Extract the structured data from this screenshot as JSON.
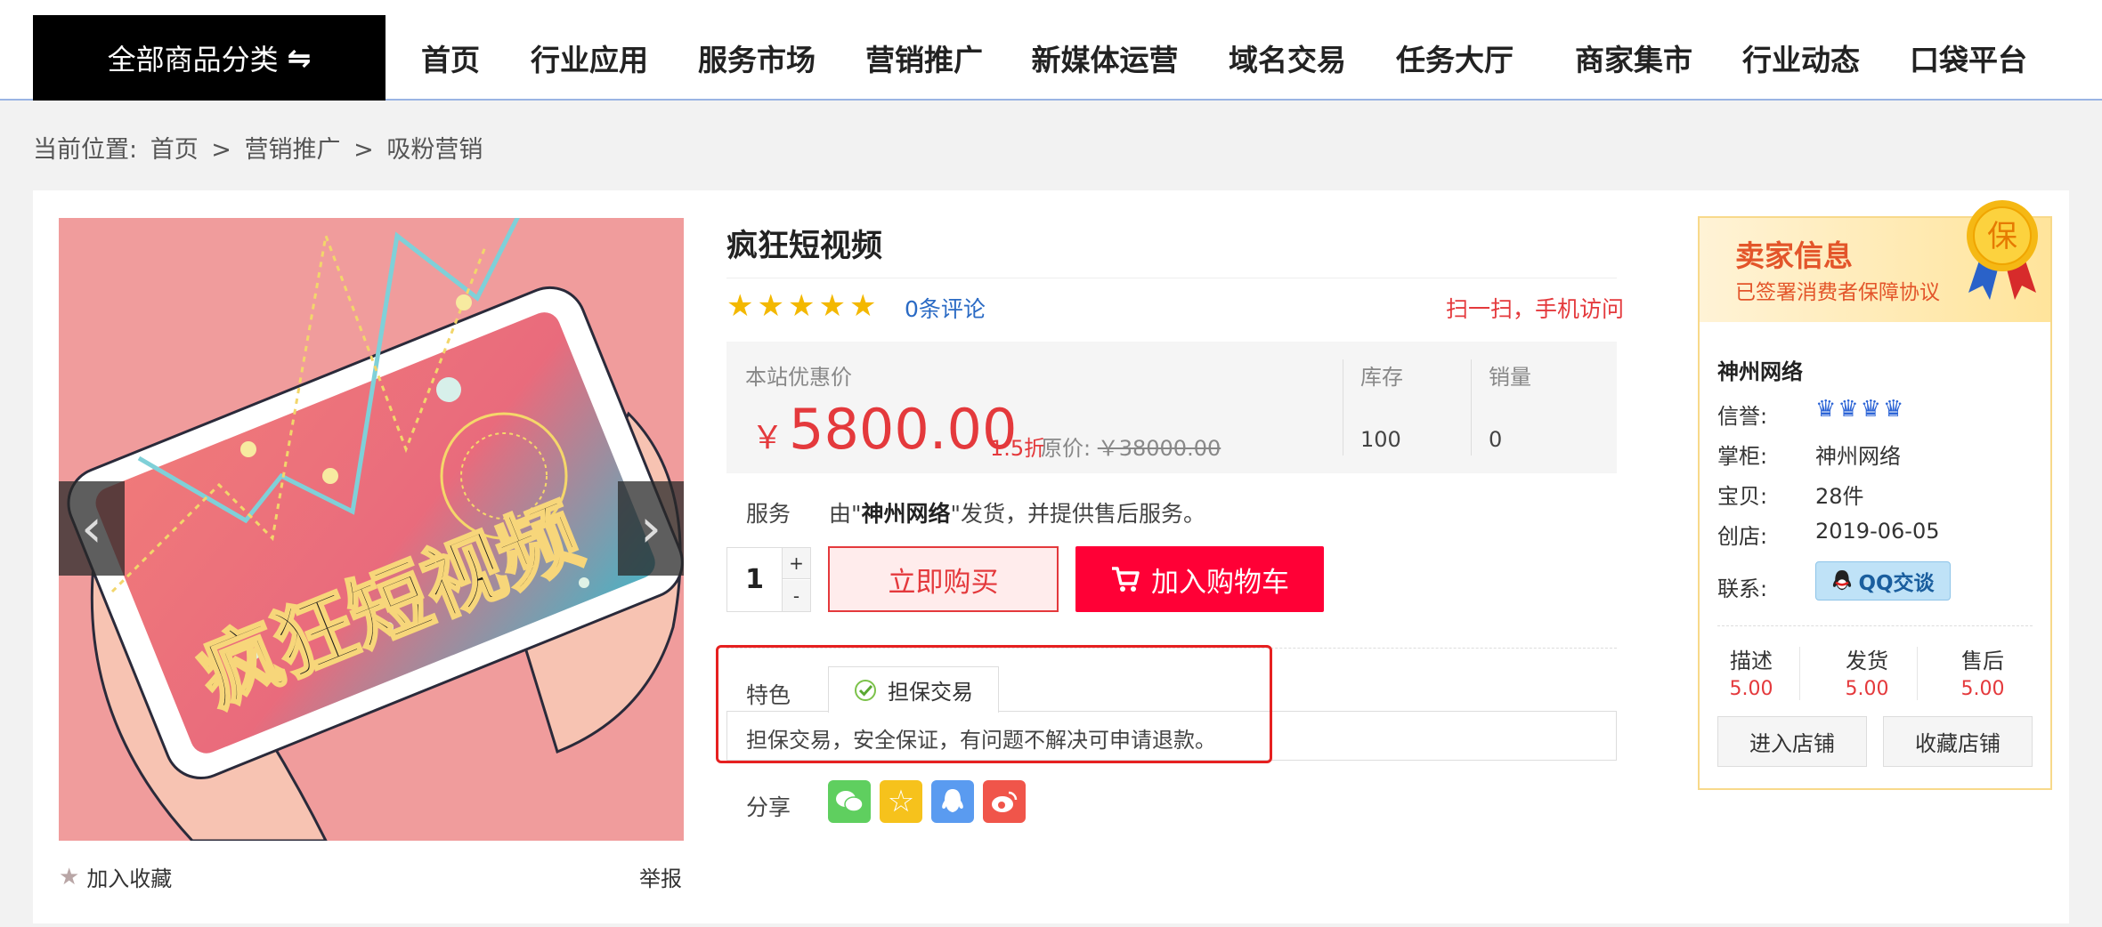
{
  "nav": {
    "category_label": "全部商品分类",
    "menu": [
      "首页",
      "行业应用",
      "服务市场",
      "营销推广",
      "新媒体运营",
      "域名交易",
      "任务大厅",
      "商家集市",
      "行业动态",
      "口袋平台"
    ]
  },
  "breadcrumb": {
    "prefix": "当前位置:",
    "items": [
      "首页",
      "营销推广",
      "吸粉营销"
    ],
    "separator": ">"
  },
  "gallery": {
    "image_text": "疯狂短视频",
    "add_favorite": "加入收藏",
    "report": "举报"
  },
  "product": {
    "title": "疯狂短视频",
    "rating_stars": 5,
    "reviews": "0条评论",
    "scan_text": "扫一扫，手机访问",
    "price_label": "本站优惠价",
    "currency": "￥",
    "price": "5800.00",
    "discount": "1.5折",
    "original_label": "原价:",
    "original_price": "￥38000.00",
    "stock_label": "库存",
    "stock_value": "100",
    "sales_label": "销量",
    "sales_value": "0",
    "service_label": "服务",
    "service_prefix": "由\"",
    "service_shop": "神州网络",
    "service_suffix": "\"发货，并提供售后服务。",
    "quantity": "1",
    "plus": "+",
    "minus": "-",
    "buy_now": "立即购买",
    "add_to_cart": "加入购物车",
    "feature_label": "特色",
    "feature_tab": "担保交易",
    "feature_desc": "担保交易，安全保证，有问题不解决可申请退款。",
    "share_label": "分享"
  },
  "seller": {
    "title": "卖家信息",
    "subtitle": "已签署消费者保障协议",
    "badge": "保",
    "name": "神州网络",
    "credit_label": "信誉:",
    "shop_label": "掌柜:",
    "shop_value": "神州网络",
    "items_label": "宝贝:",
    "items_value": "28件",
    "founded_label": "创店:",
    "founded_value": "2019-06-05",
    "contact_label": "联系:",
    "qq_label": "QQ交谈",
    "scores": [
      {
        "label": "描述",
        "value": "5.00"
      },
      {
        "label": "发货",
        "value": "5.00"
      },
      {
        "label": "售后",
        "value": "5.00"
      }
    ],
    "enter_shop": "进入店铺",
    "collect_shop": "收藏店铺"
  },
  "colors": {
    "accent_red": "#e4393c",
    "cart_red": "#ff0036",
    "link_blue": "#2a6ac4",
    "seller_orange": "#e3552a"
  }
}
